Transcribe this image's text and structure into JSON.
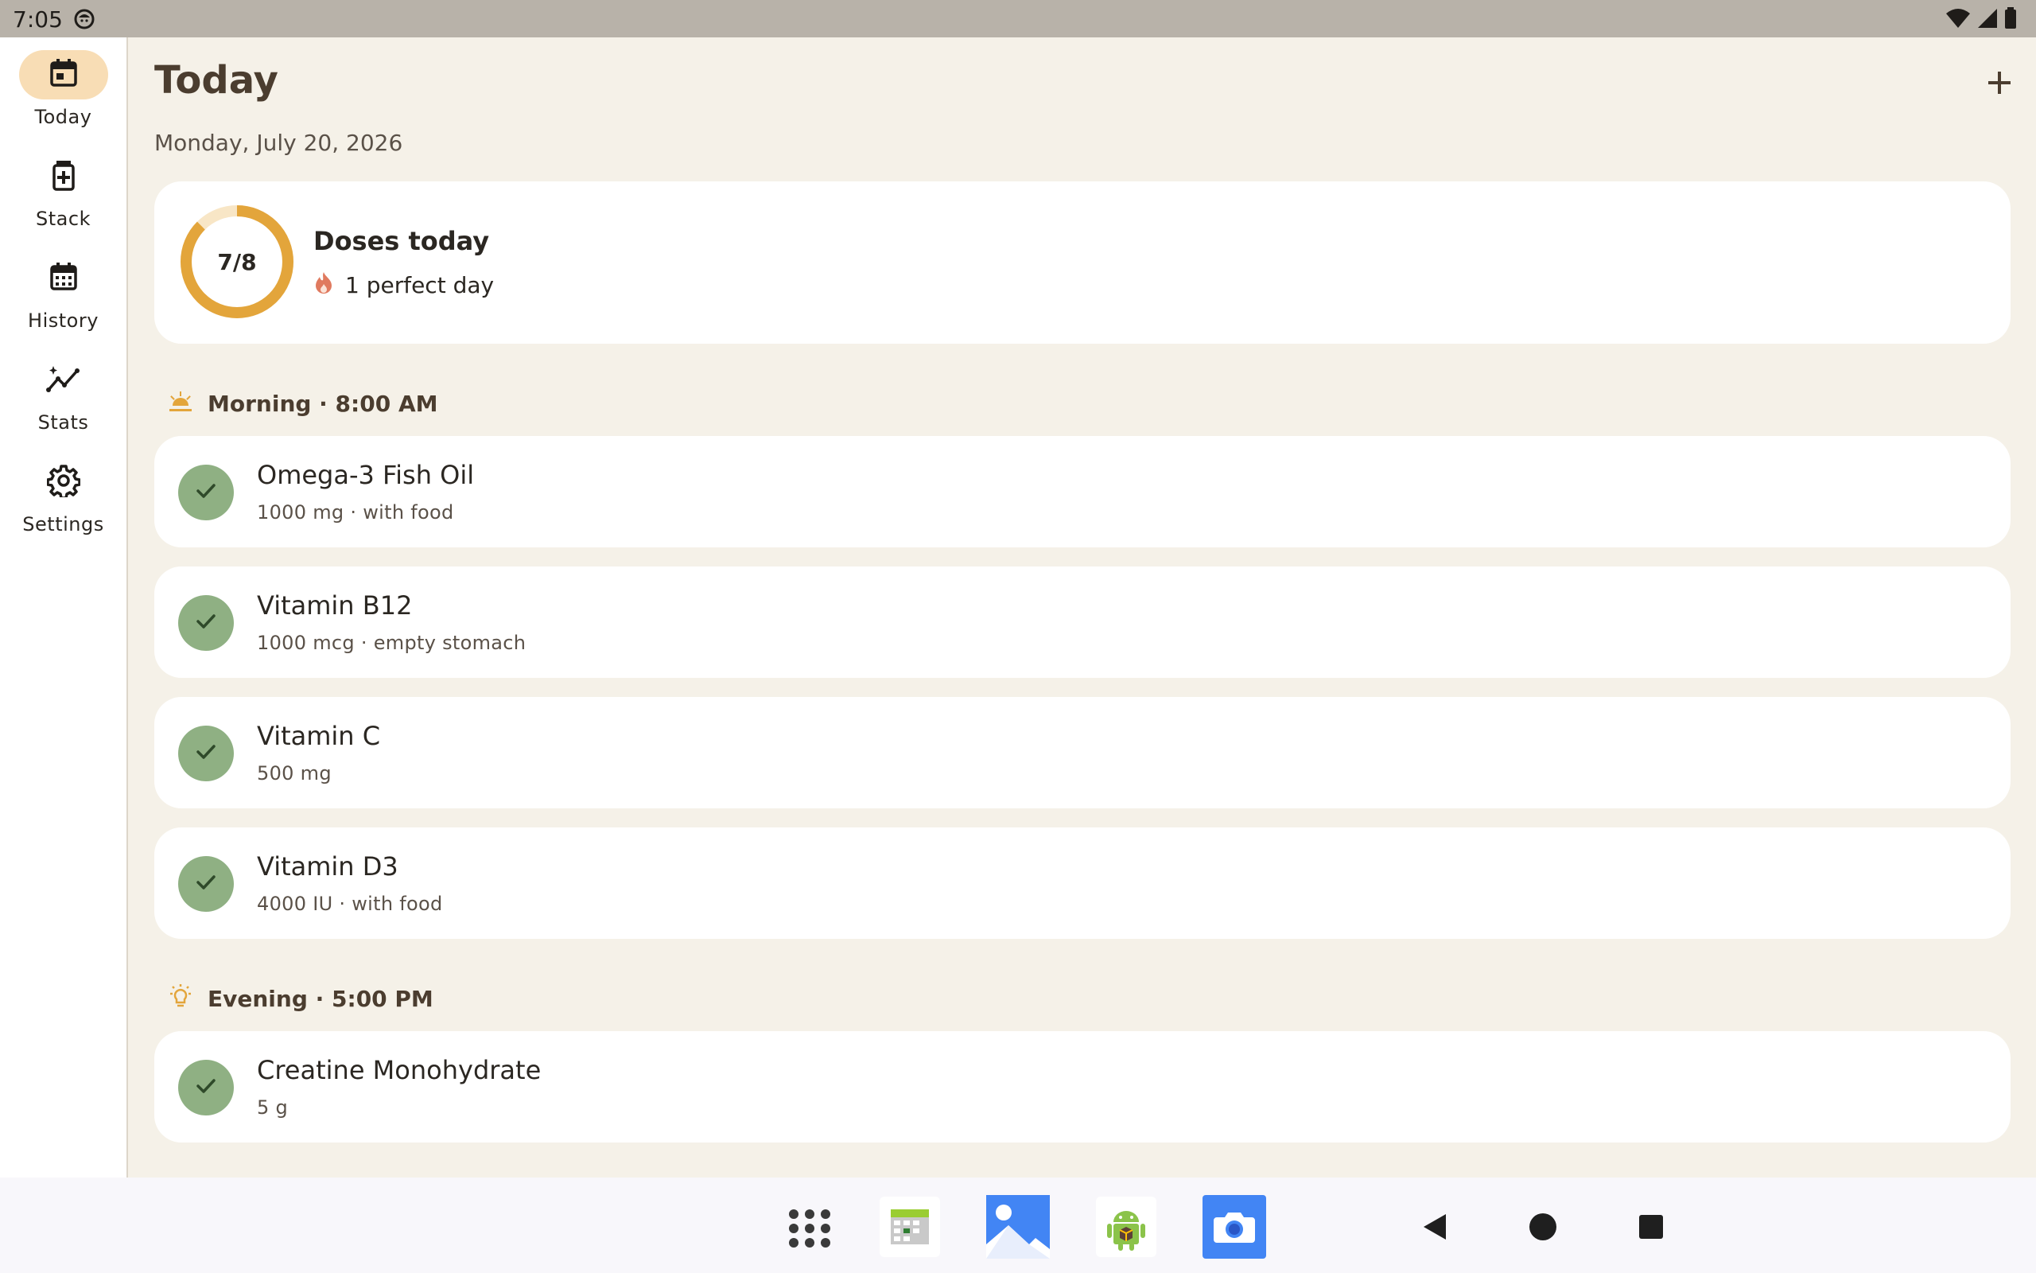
{
  "status": {
    "time": "7:05"
  },
  "nav": {
    "items": [
      {
        "label": "Today",
        "icon": "calendar-today-icon",
        "active": true
      },
      {
        "label": "Stack",
        "icon": "medication-icon",
        "active": false
      },
      {
        "label": "History",
        "icon": "calendar-month-icon",
        "active": false
      },
      {
        "label": "Stats",
        "icon": "insights-icon",
        "active": false
      },
      {
        "label": "Settings",
        "icon": "gear-icon",
        "active": false
      }
    ]
  },
  "header": {
    "title": "Today",
    "date": "Monday, July 20, 2026",
    "add_icon": "plus-icon"
  },
  "summary": {
    "progress_text": "7/8",
    "progress_fraction": 0.875,
    "title": "Doses today",
    "streak": "1 perfect day"
  },
  "sections": [
    {
      "title": "Morning · 8:00 AM",
      "icon": "sunrise-icon",
      "items": [
        {
          "name": "Omega-3 Fish Oil",
          "detail": "1000 mg · with food",
          "taken": true
        },
        {
          "name": "Vitamin B12",
          "detail": "1000 mcg · empty stomach",
          "taken": true
        },
        {
          "name": "Vitamin C",
          "detail": "500 mg",
          "taken": true
        },
        {
          "name": "Vitamin D3",
          "detail": "4000 IU · with food",
          "taken": true
        }
      ]
    },
    {
      "title": "Evening · 5:00 PM",
      "icon": "lightbulb-icon",
      "items": [
        {
          "name": "Creatine Monohydrate",
          "detail": "5 g",
          "taken": true
        }
      ]
    }
  ],
  "colors": {
    "accent": "#e3a53b",
    "check": "#8fb083",
    "background": "#f5f1e8",
    "rail_active": "#f8ddb5"
  },
  "taskbar": {
    "apps": [
      "app-drawer-icon",
      "calendar-app-icon",
      "gallery-app-icon",
      "android-app-icon",
      "camera-app-icon"
    ],
    "nav": [
      "back-icon",
      "home-icon",
      "recents-icon"
    ]
  }
}
